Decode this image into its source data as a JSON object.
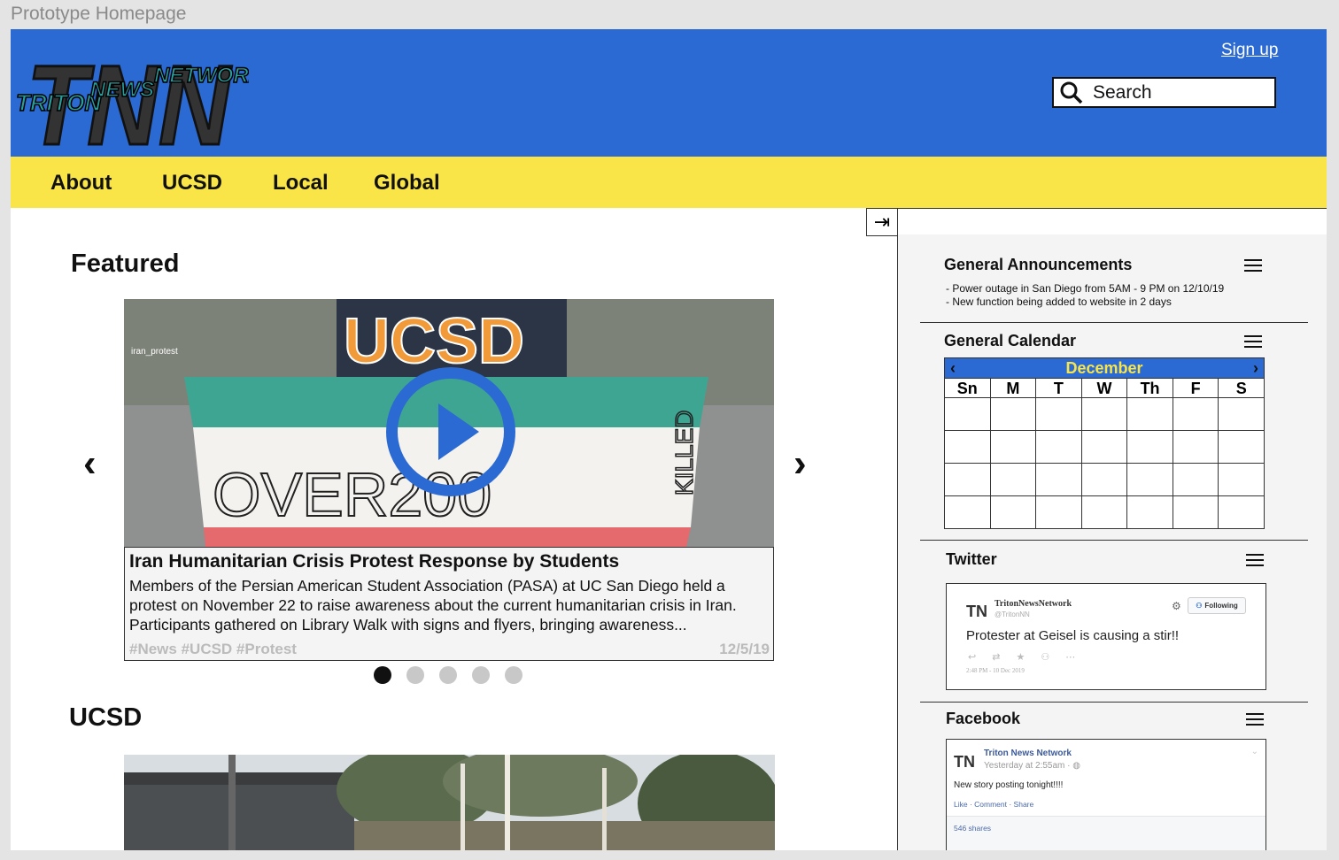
{
  "prototype_title": "Prototype Homepage",
  "header": {
    "logo": {
      "big": "TNN",
      "word1": "TRITON",
      "word2": "NEWS",
      "word3": "NETWORK"
    },
    "signup_label": "Sign up",
    "search_placeholder": "Search"
  },
  "nav": {
    "items": [
      "About",
      "UCSD",
      "Local",
      "Global"
    ]
  },
  "featured": {
    "title": "Featured",
    "image_tag": "iran_protest",
    "image_text": {
      "shirt": "UCSD",
      "sign": "OVER200",
      "sign_side": "KILLED"
    },
    "article_title": "Iran Humanitarian Crisis Protest Response by Students",
    "article_body": "Members of the Persian American Student Association (PASA) at UC San Diego held a protest on November 22 to raise awareness about the current humanitarian crisis in Iran. Participants gathered on Library Walk with signs and flyers, bringing awareness...",
    "tags": "#News #UCSD #Protest",
    "date": "12/5/19",
    "dots": 5,
    "active_dot": 0
  },
  "ucsd_section": {
    "title": "UCSD"
  },
  "sidebar": {
    "collapse_icon": "collapse-right-icon",
    "announcements": {
      "title": "General Announcements",
      "items": [
        "- Power outage in San Diego from 5AM - 9 PM on 12/10/19",
        "- New function being added to website in 2 days"
      ]
    },
    "calendar": {
      "title": "General Calendar",
      "month": "December",
      "days": [
        "Sn",
        "M",
        "T",
        "W",
        "Th",
        "F",
        "S"
      ]
    },
    "twitter": {
      "title": "Twitter",
      "account": "TritonNewsNetwork",
      "handle": "@TritonNN",
      "follow_label": "Following",
      "text": "Protester at Geisel is causing a stir!!",
      "time": "2:48 PM - 10 Dec 2019"
    },
    "facebook": {
      "title": "Facebook",
      "account": "Triton News Network",
      "time": "Yesterday at 2:55am · ",
      "text": "New story posting tonight!!!!",
      "actions": "Like · Comment · Share",
      "shares": "546 shares"
    }
  },
  "colors": {
    "header_blue": "#2b6ad3",
    "nav_yellow": "#f9e547"
  }
}
